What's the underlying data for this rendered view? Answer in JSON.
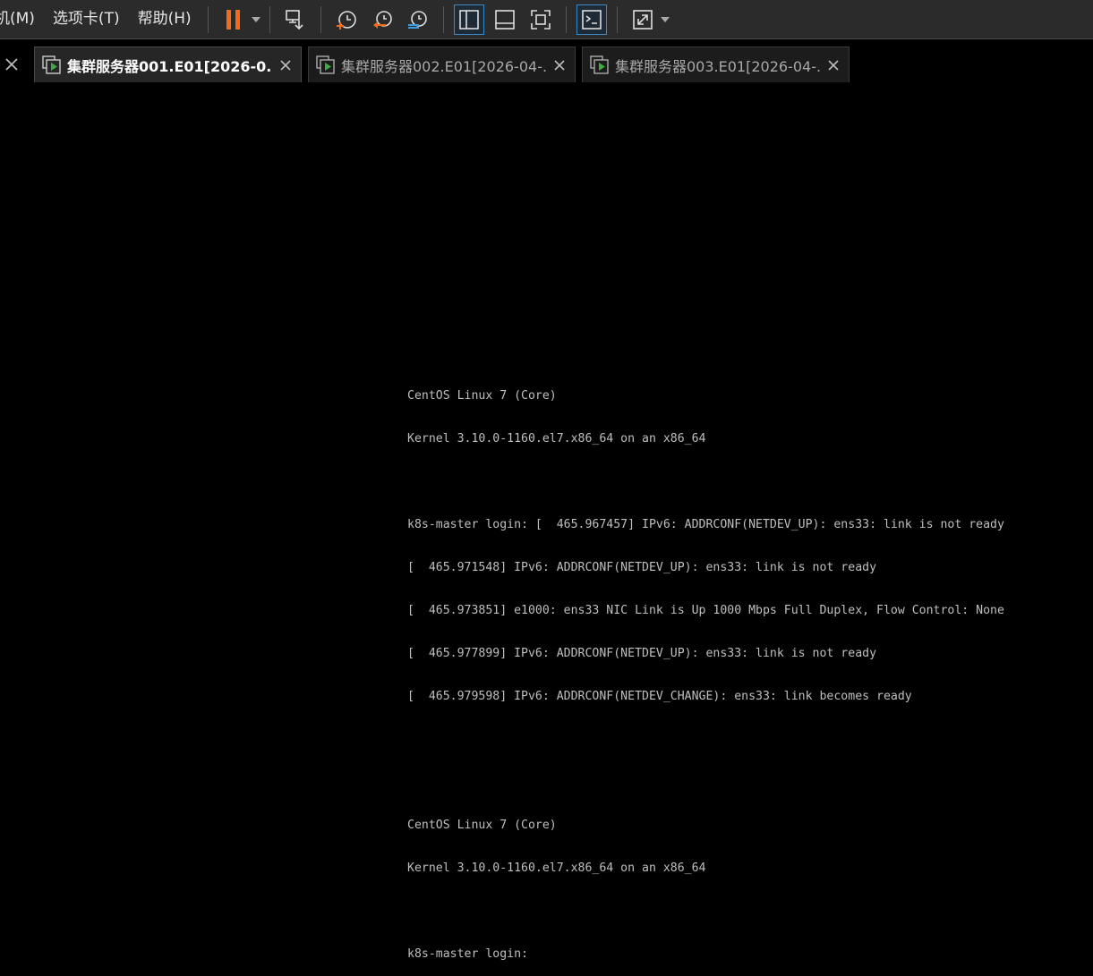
{
  "menu": {
    "items": [
      {
        "label": "机(M)"
      },
      {
        "label": "选项卡(T)"
      },
      {
        "label": "帮助(H)"
      }
    ]
  },
  "toolbar": {
    "icons": [
      "pause-icon",
      "dropdown-icon",
      "send-ctrl-alt-del-icon",
      "snapshot-take-icon",
      "snapshot-revert-icon",
      "snapshot-manager-icon",
      "view-sidebar-icon",
      "view-thumbnail-icon",
      "fullscreen-fit-icon",
      "console-icon",
      "stretch-icon",
      "dropdown-icon"
    ],
    "accent": "#f26b1d",
    "active_border": "#3b87c4"
  },
  "tabs": [
    {
      "title": "集群服务器001.E01[2026-0...",
      "active": true
    },
    {
      "title": "集群服务器002.E01[2026-04-...",
      "active": false
    },
    {
      "title": "集群服务器003.E01[2026-04-...",
      "active": false
    }
  ],
  "console": {
    "lines": [
      "CentOS Linux 7 (Core)",
      "Kernel 3.10.0-1160.el7.x86_64 on an x86_64",
      "",
      "k8s-master login: [  465.967457] IPv6: ADDRCONF(NETDEV_UP): ens33: link is not ready",
      "[  465.971548] IPv6: ADDRCONF(NETDEV_UP): ens33: link is not ready",
      "[  465.973851] e1000: ens33 NIC Link is Up 1000 Mbps Full Duplex, Flow Control: None",
      "[  465.977899] IPv6: ADDRCONF(NETDEV_UP): ens33: link is not ready",
      "[  465.979598] IPv6: ADDRCONF(NETDEV_CHANGE): ens33: link becomes ready",
      "",
      "",
      "CentOS Linux 7 (Core)",
      "Kernel 3.10.0-1160.el7.x86_64 on an x86_64",
      "",
      "k8s-master login: "
    ]
  }
}
